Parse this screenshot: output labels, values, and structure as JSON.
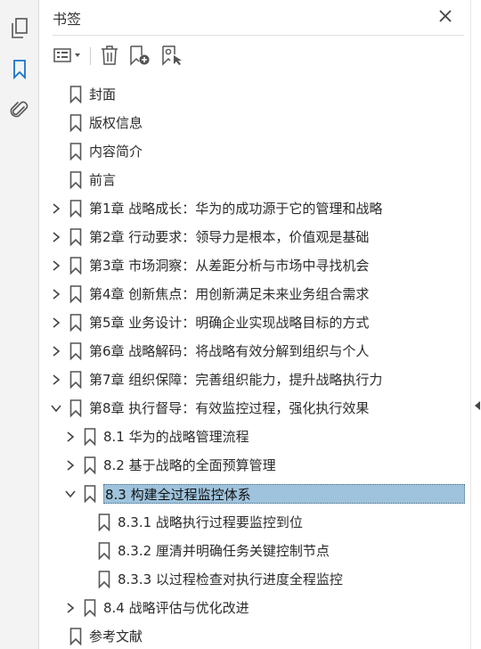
{
  "panel": {
    "title": "书签"
  },
  "rail": {
    "buttons": [
      {
        "icon": "pages-icon"
      },
      {
        "icon": "bookmarks-icon",
        "active": true
      },
      {
        "icon": "attachments-icon"
      }
    ]
  },
  "toolbar": {
    "buttons": [
      "options-menu-icon",
      "delete-bookmark-icon",
      "new-bookmark-icon",
      "new-bookmark-from-structure-icon"
    ]
  },
  "bookmarks": [
    {
      "label": "封面",
      "level": 0,
      "expander": "none"
    },
    {
      "label": "版权信息",
      "level": 0,
      "expander": "none"
    },
    {
      "label": "内容简介",
      "level": 0,
      "expander": "none"
    },
    {
      "label": "前言",
      "level": 0,
      "expander": "none"
    },
    {
      "label": "第1章 战略成长：华为的成功源于它的管理和战略",
      "level": 0,
      "expander": "collapsed"
    },
    {
      "label": "第2章 行动要求：领导力是根本，价值观是基础",
      "level": 0,
      "expander": "collapsed"
    },
    {
      "label": "第3章 市场洞察：从差距分析与市场中寻找机会",
      "level": 0,
      "expander": "collapsed"
    },
    {
      "label": "第4章 创新焦点：用创新满足未来业务组合需求",
      "level": 0,
      "expander": "collapsed"
    },
    {
      "label": "第5章 业务设计：明确企业实现战略目标的方式",
      "level": 0,
      "expander": "collapsed"
    },
    {
      "label": "第6章 战略解码：将战略有效分解到组织与个人",
      "level": 0,
      "expander": "collapsed"
    },
    {
      "label": "第7章 组织保障：完善组织能力，提升战略执行力",
      "level": 0,
      "expander": "collapsed"
    },
    {
      "label": "第8章 执行督导：有效监控过程，强化执行效果",
      "level": 0,
      "expander": "expanded"
    },
    {
      "label": "8.1 华为的战略管理流程",
      "level": 1,
      "expander": "collapsed"
    },
    {
      "label": "8.2 基于战略的全面预算管理",
      "level": 1,
      "expander": "collapsed"
    },
    {
      "label": "8.3 构建全过程监控体系",
      "level": 1,
      "expander": "expanded",
      "selected": true
    },
    {
      "label": "8.3.1 战略执行过程要监控到位",
      "level": 2,
      "expander": "none"
    },
    {
      "label": "8.3.2 厘清并明确任务关键控制节点",
      "level": 2,
      "expander": "none"
    },
    {
      "label": "8.3.3 以过程检查对执行进度全程监控",
      "level": 2,
      "expander": "none"
    },
    {
      "label": "8.4 战略评估与优化改进",
      "level": 1,
      "expander": "collapsed"
    },
    {
      "label": "参考文献",
      "level": 0,
      "expander": "none"
    }
  ],
  "colors": {
    "selection": "#9fc3dc",
    "active_icon": "#1a73c8",
    "icon": "#555555"
  }
}
